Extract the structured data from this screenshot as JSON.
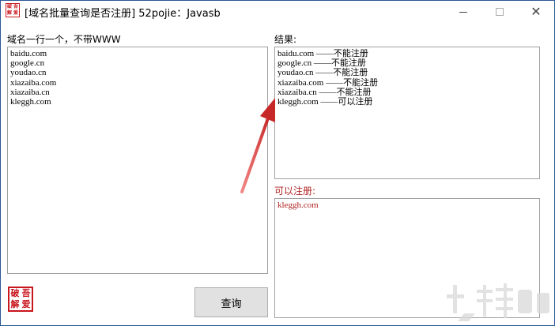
{
  "window": {
    "title": "[域名批量查询是否注册] 52pojie：Javasb",
    "icon_chars": [
      "破",
      "吾",
      "解",
      "爱"
    ],
    "controls": {
      "minimize": "minimize-icon",
      "maximize": "maximize-icon",
      "close": "close-icon",
      "close_glyph": "✕"
    }
  },
  "input_panel": {
    "label": "域名一行一个，不带WWW",
    "lines": [
      "baidu.com",
      "google.cn",
      "youdao.cn",
      "xiazaiba.com",
      "xiazaiba.cn",
      "kleggh.com"
    ]
  },
  "results_panel": {
    "label": "结果:",
    "lines": [
      "baidu.com ——不能注册",
      "google.cn ——不能注册",
      "youdao.cn ——不能注册",
      "xiazaiba.com ——不能注册",
      "xiazaiba.cn ——不能注册",
      "kleggh.com ——可以注册"
    ]
  },
  "available_panel": {
    "label": "可以注册:",
    "lines": [
      "kleggh.com"
    ]
  },
  "query_button": {
    "label": "查询"
  },
  "logo": {
    "chars": [
      "破",
      "吾",
      "解",
      "爱"
    ]
  },
  "colors": {
    "accent_red": "#b22222",
    "logo_red": "#c8161d",
    "window_border": "#2b5797",
    "arrow_red": "#c62828"
  }
}
